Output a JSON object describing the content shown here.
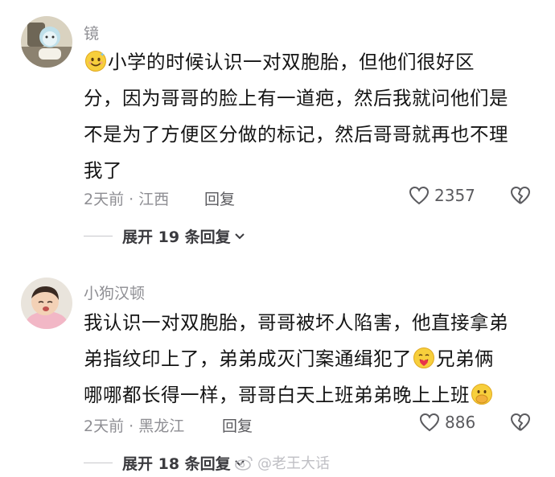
{
  "comments": [
    {
      "username": "镜",
      "lines": [
        "小学的时候认识一对双胞胎，但他们很好区",
        "分，因为哥哥的脸上有一道疤，然后我就问他们是",
        "不是为了方便区分做的标记，然后哥哥就再也不理",
        "我了"
      ],
      "time_location": "2天前 · 江西",
      "reply_label": "回复",
      "likes": "2357",
      "expand_label": "展开 19 条回复"
    },
    {
      "username": "小狗汉顿",
      "lines": [
        "我认识一对双胞胎，哥哥被坏人陷害，他直接拿弟",
        "弟指纹印上了，弟弟成灭门案通缉犯了",
        "兄弟俩",
        "哪哪都长得一样，哥哥白天上班弟弟晚上上班"
      ],
      "time_location": "2天前 · 黑龙江",
      "reply_label": "回复",
      "likes": "886",
      "expand_label": "展开 18 条回复"
    }
  ],
  "watermark": "@老王大话",
  "icons": {
    "smile_emoji": "smiling-face-emoji",
    "hug_emoji": "smiling-face-with-hearts-emoji",
    "shy_emoji": "face-with-hand-over-mouth-emoji",
    "like": "heart-outline-icon",
    "dislike": "broken-heart-icon",
    "expand": "chevron-down-icon"
  },
  "colors": {
    "secondary_text": "#8e8e93",
    "body_text": "#141414"
  }
}
